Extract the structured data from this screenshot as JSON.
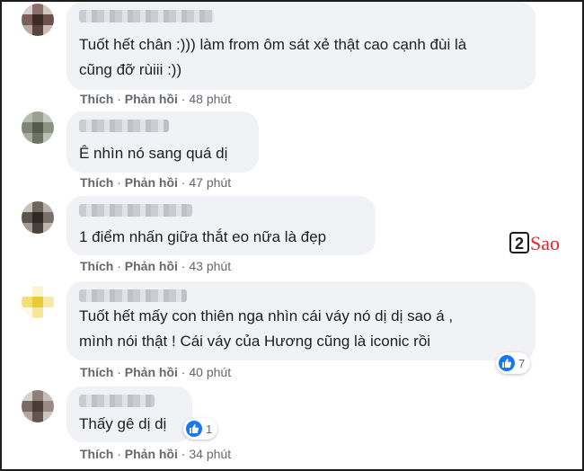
{
  "comments": [
    {
      "text_lines": [
        "Tuốt hết chân :))) làm from ôm sát xẻ thật cao cạnh đùi là",
        "cũng đỡ rùiii :))"
      ],
      "like": "Thích",
      "reply": "Phản hồi",
      "time": "48 phút"
    },
    {
      "text_lines": [
        "Ê nhìn nó sang quá dị"
      ],
      "like": "Thích",
      "reply": "Phản hồi",
      "time": "47 phút"
    },
    {
      "text_lines": [
        "1 điểm nhấn giữa thắt eo nữa là đẹp"
      ],
      "like": "Thích",
      "reply": "Phản hồi",
      "time": "43 phút"
    },
    {
      "text_lines": [
        "Tuốt hết mấy con thiên nga nhìn cái váy nó dị dị sao á ,",
        "mình nói thật ! Cái váy của Hương cũng là iconic rồi"
      ],
      "like": "Thích",
      "reply": "Phản hồi",
      "time": "40 phút",
      "reaction_count": "7"
    },
    {
      "text_lines": [
        "Thấy gê dị dị"
      ],
      "like": "Thích",
      "reply": "Phản hồi",
      "time": "34 phút",
      "reaction_count": "1"
    }
  ],
  "watermark": {
    "number": "2",
    "word": "Sao"
  },
  "colors": {
    "bubble": "#f0f2f5",
    "like_blue": "#1877f2",
    "meta_gray": "#65676b",
    "watermark_red": "#e0262b"
  }
}
